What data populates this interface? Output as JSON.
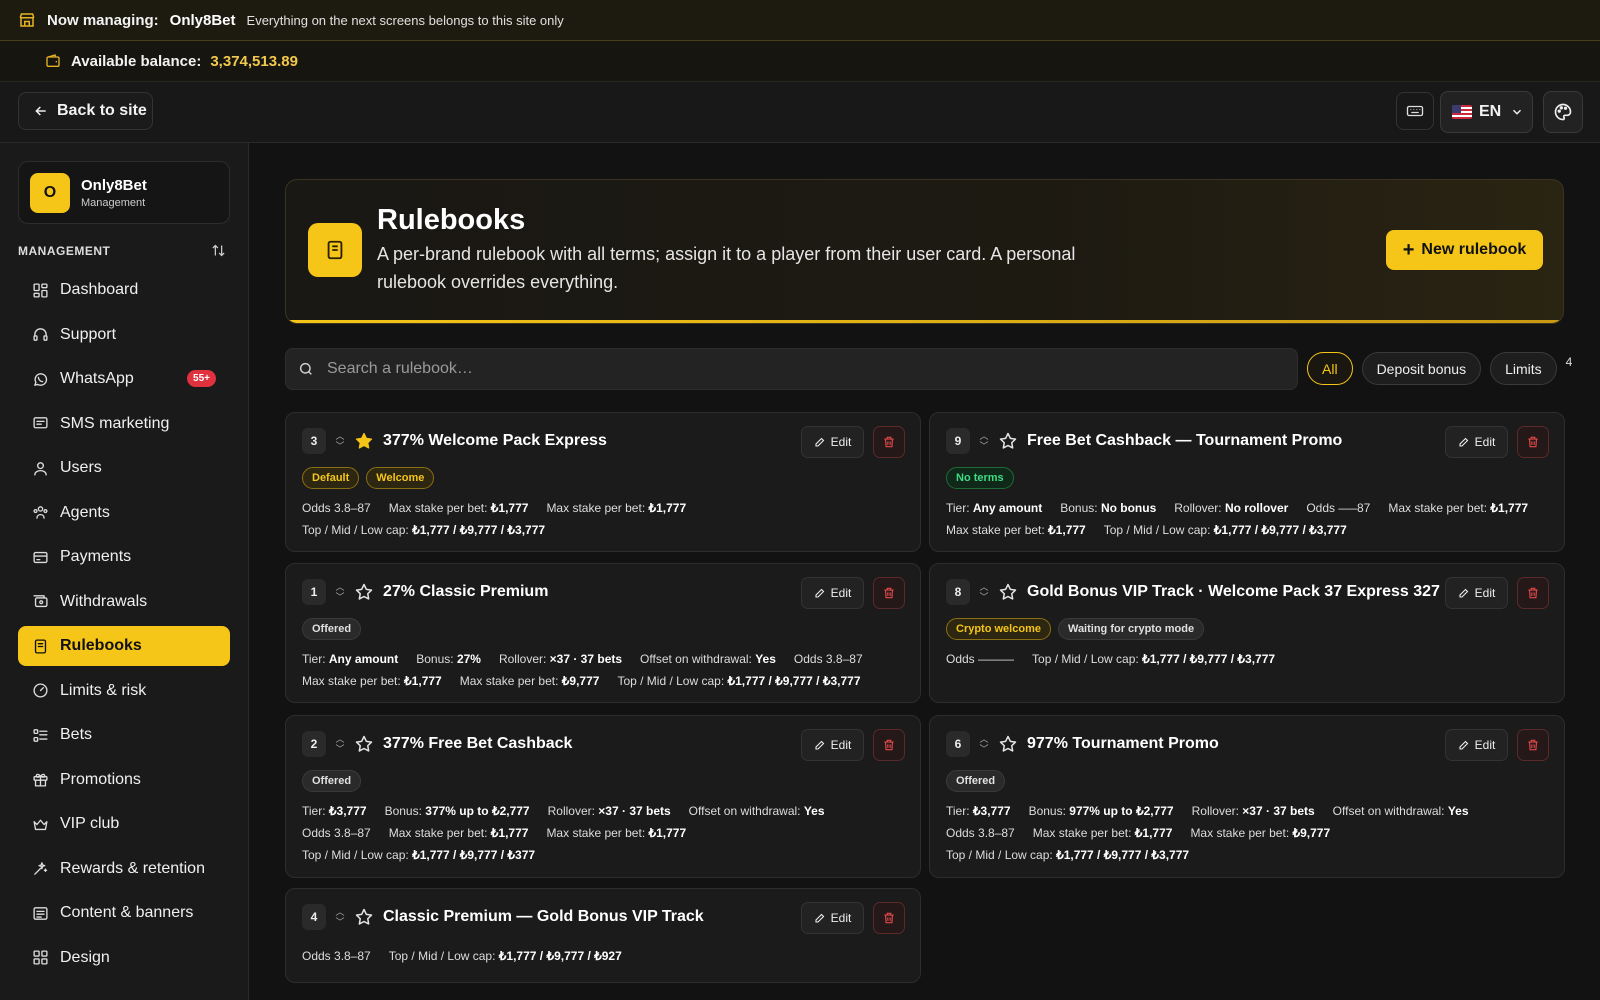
{
  "banner": {
    "label": "Now managing:",
    "brand": "Only8Bet",
    "note": "Everything on the next screens belongs to this site only"
  },
  "balance": {
    "label": "Available balance:",
    "value": "3,374,513.89"
  },
  "header": {
    "back_label": "Back to site",
    "lang": "EN"
  },
  "sidebar": {
    "brand_initial": "O",
    "brand_name": "Only8Bet",
    "brand_sub": "Management",
    "section_title": "MANAGEMENT",
    "items": [
      {
        "label": "Dashboard",
        "icon": "dashboard-icon"
      },
      {
        "label": "Support",
        "icon": "headset-icon"
      },
      {
        "label": "WhatsApp",
        "icon": "whatsapp-icon",
        "badge": "55+"
      },
      {
        "label": "SMS marketing",
        "icon": "message-icon"
      },
      {
        "label": "Users",
        "icon": "users-icon"
      },
      {
        "label": "Agents",
        "icon": "agents-icon"
      },
      {
        "label": "Payments",
        "icon": "card-icon"
      },
      {
        "label": "Withdrawals",
        "icon": "withdraw-icon"
      },
      {
        "label": "Rulebooks",
        "icon": "book-icon",
        "active": true
      },
      {
        "label": "Limits & risk",
        "icon": "gauge-icon"
      },
      {
        "label": "Bets",
        "icon": "list-icon"
      },
      {
        "label": "Promotions",
        "icon": "gift-icon"
      },
      {
        "label": "VIP club",
        "icon": "crown-icon"
      },
      {
        "label": "Rewards & retention",
        "icon": "sparkle-icon"
      },
      {
        "label": "Content & banners",
        "icon": "content-icon"
      },
      {
        "label": "Design",
        "icon": "grid-icon"
      }
    ]
  },
  "page": {
    "title": "Rulebooks",
    "description": "A per-brand rulebook with all terms; assign it to a player from their user card. A personal rulebook overrides everything.",
    "new_button": "New rulebook",
    "search_placeholder": "Search a rulebook…",
    "filters": [
      "All",
      "Deposit bonus",
      "Limits"
    ],
    "count": "4"
  },
  "cards": [
    {
      "pos": "3",
      "title": "377% Welcome Pack Express",
      "starred": true,
      "edit": "Edit",
      "tags": [
        {
          "text": "Default",
          "style": "yellow"
        },
        {
          "text": "Welcome",
          "style": "yellow"
        }
      ],
      "lines": [
        [
          [
            "Odds 3.8–87",
            ""
          ],
          [
            "Max stake per bet: ",
            "₺1,777"
          ],
          [
            "Max stake per bet: ",
            "₺1,777"
          ]
        ],
        [
          [
            "Top / Mid / Low cap: ",
            "₺1,777 / ₺9,777 / ₺3,777"
          ]
        ]
      ]
    },
    {
      "pos": "9",
      "title": "Free Bet Cashback — Tournament Promo",
      "starred": false,
      "edit": "Edit",
      "tags": [
        {
          "text": "No terms",
          "style": "green"
        }
      ],
      "lines": [
        [
          [
            "Tier: ",
            "Any amount"
          ],
          [
            "Bonus: ",
            "No bonus"
          ],
          [
            "Rollover: ",
            "No rollover"
          ],
          [
            "Odds —–87",
            ""
          ],
          [
            "Max stake per bet: ",
            "₺1,777"
          ]
        ],
        [
          [
            "Max stake per bet: ",
            "₺1,777"
          ],
          [
            "Top / Mid / Low cap: ",
            "₺1,777 / ₺9,777 / ₺3,777"
          ]
        ]
      ]
    },
    {
      "pos": "1",
      "title": "27% Classic Premium",
      "starred": false,
      "edit": "Edit",
      "tags": [
        {
          "text": "Offered",
          "style": "gray"
        }
      ],
      "lines": [
        [
          [
            "Tier: ",
            "Any amount"
          ],
          [
            "Bonus: ",
            "27%"
          ],
          [
            "Rollover: ",
            "×37 · 37 bets"
          ],
          [
            "Offset on withdrawal: ",
            "Yes"
          ],
          [
            "Odds 3.8–87",
            ""
          ]
        ],
        [
          [
            "Max stake per bet: ",
            "₺1,777"
          ],
          [
            "Max stake per bet: ",
            "₺9,777"
          ],
          [
            "Top / Mid / Low cap: ",
            "₺1,777 / ₺9,777 / ₺3,777"
          ]
        ]
      ]
    },
    {
      "pos": "8",
      "title": "Gold Bonus VIP Track · Welcome Pack 37 Express 327",
      "starred": false,
      "edit": "Edit",
      "tags": [
        {
          "text": "Crypto welcome",
          "style": "yellow"
        },
        {
          "text": "Waiting for crypto mode",
          "style": "gray"
        }
      ],
      "lines": [
        [
          [
            "Odds ———",
            ""
          ],
          [
            "Top / Mid / Low cap: ",
            "₺1,777 / ₺9,777 / ₺3,777"
          ]
        ]
      ]
    },
    {
      "pos": "2",
      "title": "377% Free Bet Cashback",
      "starred": false,
      "edit": "Edit",
      "tags": [
        {
          "text": "Offered",
          "style": "gray"
        }
      ],
      "lines": [
        [
          [
            "Tier: ",
            "₺3,777"
          ],
          [
            "Bonus: ",
            "377% up to ₺2,777"
          ],
          [
            "Rollover: ",
            "×37 · 37 bets"
          ],
          [
            "Offset on withdrawal: ",
            "Yes"
          ]
        ],
        [
          [
            "Odds 3.8–87",
            ""
          ],
          [
            "Max stake per bet: ",
            "₺1,777"
          ],
          [
            "Max stake per bet: ",
            "₺1,777"
          ]
        ],
        [
          [
            "Top / Mid / Low cap: ",
            "₺1,777 / ₺9,777 / ₺377"
          ]
        ]
      ]
    },
    {
      "pos": "6",
      "title": "977% Tournament Promo",
      "starred": false,
      "edit": "Edit",
      "tags": [
        {
          "text": "Offered",
          "style": "gray"
        }
      ],
      "lines": [
        [
          [
            "Tier: ",
            "₺3,777"
          ],
          [
            "Bonus: ",
            "977% up to ₺2,777"
          ],
          [
            "Rollover: ",
            "×37 · 37 bets"
          ],
          [
            "Offset on withdrawal: ",
            "Yes"
          ]
        ],
        [
          [
            "Odds 3.8–87",
            ""
          ],
          [
            "Max stake per bet: ",
            "₺1,777"
          ],
          [
            "Max stake per bet: ",
            "₺9,777"
          ]
        ],
        [
          [
            "Top / Mid / Low cap: ",
            "₺1,777 / ₺9,777 / ₺3,777"
          ]
        ]
      ]
    },
    {
      "pos": "4",
      "title": "Classic Premium — Gold Bonus VIP Track",
      "starred": false,
      "edit": "Edit",
      "tags": [],
      "lines": [
        [
          [
            "Odds 3.8–87",
            ""
          ],
          [
            "Top / Mid / Low cap: ",
            "₺1,777 / ₺9,777 / ₺927"
          ]
        ]
      ]
    }
  ],
  "colors": {
    "accent": "#f5c518",
    "danger": "#e04848",
    "success": "#3ddc84",
    "background": "#121212"
  }
}
